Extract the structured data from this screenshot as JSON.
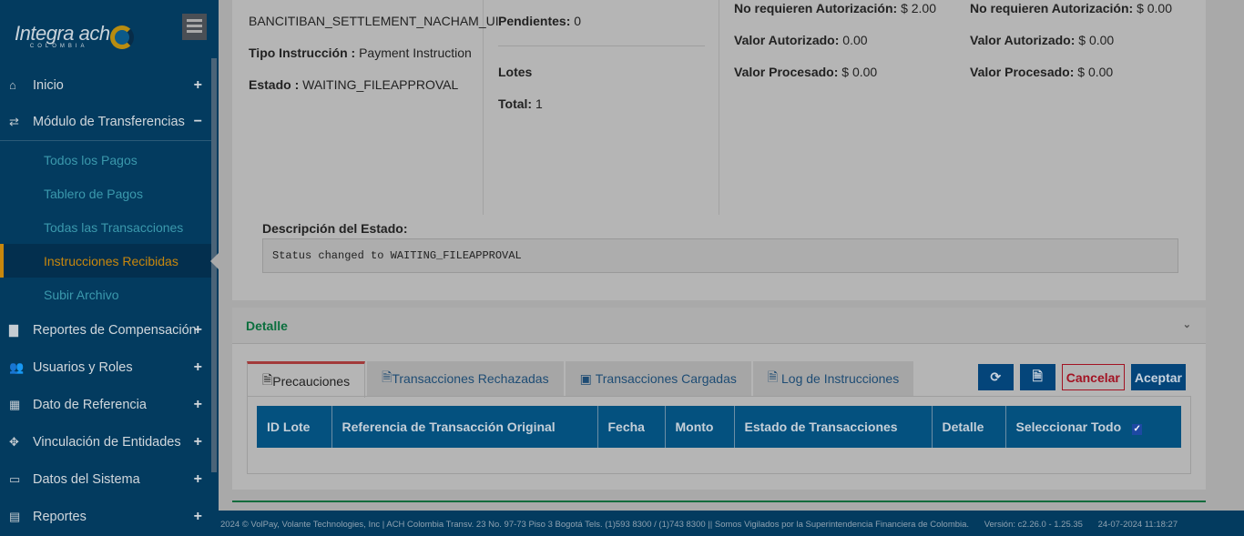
{
  "sidebar": {
    "logo": "Integra ach",
    "logo_sub": "COLOMBIA",
    "items": [
      {
        "label": "Inicio",
        "icon": "home-icon",
        "sign": "+"
      },
      {
        "label": "Módulo de Transferencias",
        "icon": "exchange-icon",
        "sign": "−"
      },
      {
        "label": "Reportes de Compensación",
        "icon": "file-icon",
        "sign": "+"
      },
      {
        "label": "Usuarios y Roles",
        "icon": "users-icon",
        "sign": "+"
      },
      {
        "label": "Dato de Referencia",
        "icon": "calendar-icon",
        "sign": "+"
      },
      {
        "label": "Vinculación de Entidades",
        "icon": "crosshair-icon",
        "sign": "+"
      },
      {
        "label": "Datos del Sistema",
        "icon": "monitor-icon",
        "sign": "+"
      },
      {
        "label": "Reportes",
        "icon": "document-icon",
        "sign": "+"
      }
    ],
    "subitems": [
      "Todos los Pagos",
      "Tablero de Pagos",
      "Todas las Transacciones",
      "Instrucciones Recibidas",
      "Subir Archivo"
    ]
  },
  "info": {
    "name": "BANCITIBAN_SETTLEMENT_NACHAM_UI",
    "tipo_label": "Tipo Instrucción :",
    "tipo": "Payment Instruction",
    "estado_label": "Estado :",
    "estado": "WAITING_FILEAPPROVAL",
    "pend_label": "Pendientes:",
    "pend": "0",
    "lotes": "Lotes",
    "total_label": "Total:",
    "total": "1",
    "a1_label": "No requieren Autorización:",
    "a1": "$ 2.00",
    "a2_label": "Valor Autorizado:",
    "a2": "0.00",
    "a3_label": "Valor Procesado:",
    "a3": "$ 0.00",
    "b1_label": "No requieren Autorización:",
    "b1": "$ 0.00",
    "b2_label": "Valor Autorizado:",
    "b2": "$ 0.00",
    "b3_label": "Valor Procesado:",
    "b3": "$ 0.00",
    "desc_label": "Descripción del Estado:",
    "desc": "Status changed to WAITING_FILEAPPROVAL"
  },
  "detail": {
    "title": "Detalle",
    "tabs": [
      "Precauciones",
      "Transacciones Rechazadas",
      "Transacciones Cargadas",
      "Log de Instrucciones"
    ],
    "cancel": "Cancelar",
    "accept": "Aceptar",
    "columns": [
      "ID Lote",
      "Referencia de Transacción Original",
      "Fecha",
      "Monto",
      "Estado de Transacciones",
      "Detalle",
      "Seleccionar Todo"
    ]
  },
  "footer": {
    "copy": "2024 © VolPay, Volante Technologies, Inc | ACH Colombia Transv. 23 No. 97-73 Piso 3 Bogotá Tels. (1)593 8300 / (1)743 8300 || Somos Vigilados por la Superintendencia Financiera de Colombia.",
    "version": "Versión: c2.26.0 - 1.25.35",
    "datetime": "24-07-2024 11:18:27"
  }
}
